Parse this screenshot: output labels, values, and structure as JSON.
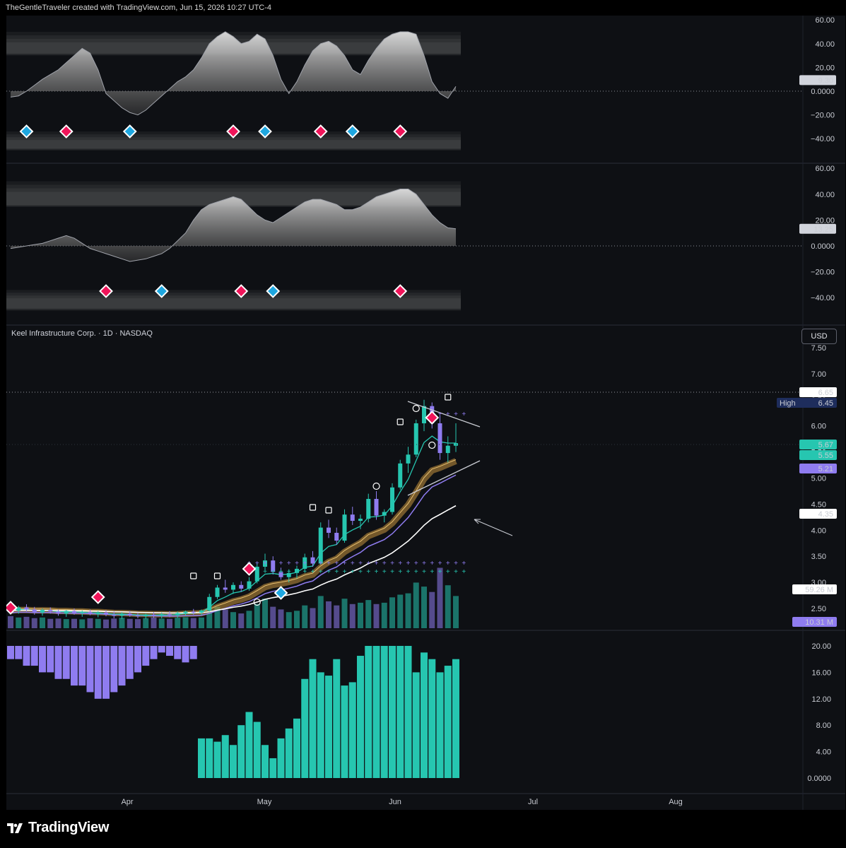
{
  "header": {
    "caption": "TheGentleTraveler created with TradingView.com, Jun 15, 2026 10:27 UTC-4"
  },
  "symbol": {
    "name": "Keel Infrastructure Corp.",
    "interval": "1D",
    "exchange": "NASDAQ",
    "legend": "Keel Infrastructure Corp. · 1D · NASDAQ"
  },
  "currency": "USD",
  "colors": {
    "background": "#0e1014",
    "teal": "#26c6b0",
    "purple": "#8f7cf0",
    "magenta": "#f0155a",
    "cyan": "#1ea7e0",
    "gold": "#b8893a",
    "white": "#ffffff"
  },
  "oscillator1": {
    "axis_ticks": [
      "60.00",
      "40.00",
      "20.00",
      "0.0000",
      "−20.00",
      "−40.00"
    ],
    "tick_values": [
      60,
      40,
      20,
      0,
      -20,
      -40
    ],
    "value_badge": "9.30",
    "value": 9.3,
    "signals": [
      {
        "bar": 2,
        "type": "bullish"
      },
      {
        "bar": 7,
        "type": "bearish"
      },
      {
        "bar": 15,
        "type": "bullish"
      },
      {
        "bar": 28,
        "type": "bearish"
      },
      {
        "bar": 32,
        "type": "bullish"
      },
      {
        "bar": 39,
        "type": "bearish"
      },
      {
        "bar": 43,
        "type": "bullish"
      },
      {
        "bar": 49,
        "type": "bearish"
      }
    ]
  },
  "oscillator2": {
    "axis_ticks": [
      "60.00",
      "40.00",
      "20.00",
      "0.0000",
      "−20.00",
      "−40.00"
    ],
    "tick_values": [
      60,
      40,
      20,
      0,
      -20,
      -40
    ],
    "value_badge": "13.25",
    "value": 13.25,
    "signals": [
      {
        "bar": 12,
        "type": "bearish"
      },
      {
        "bar": 19,
        "type": "bullish"
      },
      {
        "bar": 29,
        "type": "bearish"
      },
      {
        "bar": 33,
        "type": "bullish"
      },
      {
        "bar": 49,
        "type": "bearish"
      }
    ]
  },
  "price_pane": {
    "axis_ticks": [
      "7.50",
      "7.00",
      "6.50",
      "6.00",
      "5.50",
      "5.00",
      "4.50",
      "4.00",
      "3.50",
      "3.00",
      "2.50"
    ],
    "tick_values": [
      7.5,
      7.0,
      6.5,
      6.0,
      5.5,
      5.0,
      4.5,
      4.0,
      3.5,
      3.0,
      2.5
    ],
    "badges": {
      "last_high": "6.65",
      "high_label": "High",
      "high_value": "6.45",
      "close": "5.67",
      "ema_fast": "5.55",
      "ema_slow": "5.21",
      "sma": "4.35",
      "volume_ma": "59.26 M",
      "volume": "10.31 M"
    }
  },
  "histogram_pane": {
    "axis_ticks": [
      "20.00",
      "16.00",
      "12.00",
      "8.00",
      "4.00",
      "0.0000"
    ],
    "tick_values": [
      20,
      16,
      12,
      8,
      4,
      0
    ]
  },
  "time_axis": {
    "labels": [
      "Apr",
      "May",
      "Jun",
      "Jul",
      "Aug"
    ]
  },
  "footer": {
    "brand": "TradingView"
  },
  "chart_data": {
    "type": "candlestick",
    "title": "Keel Infrastructure Corp. · 1D · NASDAQ",
    "ylim": [
      2.5,
      7.5
    ],
    "candles": [
      {
        "o": 2.5,
        "h": 2.56,
        "l": 2.4,
        "c": 2.46
      },
      {
        "o": 2.46,
        "h": 2.55,
        "l": 2.4,
        "c": 2.52
      },
      {
        "o": 2.52,
        "h": 2.58,
        "l": 2.44,
        "c": 2.48
      },
      {
        "o": 2.48,
        "h": 2.53,
        "l": 2.38,
        "c": 2.42
      },
      {
        "o": 2.42,
        "h": 2.5,
        "l": 2.36,
        "c": 2.47
      },
      {
        "o": 2.47,
        "h": 2.52,
        "l": 2.4,
        "c": 2.44
      },
      {
        "o": 2.44,
        "h": 2.48,
        "l": 2.36,
        "c": 2.4
      },
      {
        "o": 2.4,
        "h": 2.47,
        "l": 2.34,
        "c": 2.45
      },
      {
        "o": 2.45,
        "h": 2.5,
        "l": 2.38,
        "c": 2.41
      },
      {
        "o": 2.41,
        "h": 2.46,
        "l": 2.34,
        "c": 2.43
      },
      {
        "o": 2.43,
        "h": 2.48,
        "l": 2.37,
        "c": 2.39
      },
      {
        "o": 2.39,
        "h": 2.45,
        "l": 2.33,
        "c": 2.42
      },
      {
        "o": 2.42,
        "h": 2.47,
        "l": 2.35,
        "c": 2.38
      },
      {
        "o": 2.38,
        "h": 2.44,
        "l": 2.31,
        "c": 2.36
      },
      {
        "o": 2.36,
        "h": 2.43,
        "l": 2.3,
        "c": 2.4
      },
      {
        "o": 2.4,
        "h": 2.45,
        "l": 2.34,
        "c": 2.37
      },
      {
        "o": 2.37,
        "h": 2.42,
        "l": 2.31,
        "c": 2.35
      },
      {
        "o": 2.35,
        "h": 2.4,
        "l": 2.3,
        "c": 2.38
      },
      {
        "o": 2.38,
        "h": 2.43,
        "l": 2.32,
        "c": 2.36
      },
      {
        "o": 2.36,
        "h": 2.42,
        "l": 2.31,
        "c": 2.39
      },
      {
        "o": 2.39,
        "h": 2.45,
        "l": 2.33,
        "c": 2.37
      },
      {
        "o": 2.37,
        "h": 2.44,
        "l": 2.32,
        "c": 2.41
      },
      {
        "o": 2.41,
        "h": 2.46,
        "l": 2.36,
        "c": 2.44
      },
      {
        "o": 2.44,
        "h": 2.49,
        "l": 2.38,
        "c": 2.42
      },
      {
        "o": 2.42,
        "h": 2.48,
        "l": 2.37,
        "c": 2.46
      },
      {
        "o": 2.46,
        "h": 2.78,
        "l": 2.44,
        "c": 2.72
      },
      {
        "o": 2.72,
        "h": 2.95,
        "l": 2.68,
        "c": 2.9
      },
      {
        "o": 2.9,
        "h": 3.05,
        "l": 2.8,
        "c": 2.86
      },
      {
        "o": 2.86,
        "h": 3.0,
        "l": 2.78,
        "c": 2.95
      },
      {
        "o": 2.95,
        "h": 3.02,
        "l": 2.82,
        "c": 2.88
      },
      {
        "o": 2.88,
        "h": 3.1,
        "l": 2.84,
        "c": 3.02
      },
      {
        "o": 3.02,
        "h": 3.38,
        "l": 2.98,
        "c": 3.3
      },
      {
        "o": 3.3,
        "h": 3.55,
        "l": 3.22,
        "c": 3.42
      },
      {
        "o": 3.42,
        "h": 3.5,
        "l": 3.15,
        "c": 3.2
      },
      {
        "o": 3.2,
        "h": 3.28,
        "l": 3.05,
        "c": 3.1
      },
      {
        "o": 3.1,
        "h": 3.25,
        "l": 3.0,
        "c": 3.18
      },
      {
        "o": 3.18,
        "h": 3.32,
        "l": 3.08,
        "c": 3.26
      },
      {
        "o": 3.26,
        "h": 3.55,
        "l": 3.2,
        "c": 3.48
      },
      {
        "o": 3.48,
        "h": 3.6,
        "l": 3.3,
        "c": 3.36
      },
      {
        "o": 3.36,
        "h": 4.15,
        "l": 3.34,
        "c": 4.05
      },
      {
        "o": 4.05,
        "h": 4.2,
        "l": 3.85,
        "c": 3.95
      },
      {
        "o": 3.95,
        "h": 4.05,
        "l": 3.72,
        "c": 3.8
      },
      {
        "o": 3.8,
        "h": 4.4,
        "l": 3.76,
        "c": 4.3
      },
      {
        "o": 4.3,
        "h": 4.45,
        "l": 4.1,
        "c": 4.18
      },
      {
        "o": 4.18,
        "h": 4.3,
        "l": 4.02,
        "c": 4.22
      },
      {
        "o": 4.22,
        "h": 4.7,
        "l": 4.15,
        "c": 4.6
      },
      {
        "o": 4.6,
        "h": 4.75,
        "l": 4.2,
        "c": 4.28
      },
      {
        "o": 4.28,
        "h": 4.4,
        "l": 4.15,
        "c": 4.35
      },
      {
        "o": 4.35,
        "h": 4.9,
        "l": 4.3,
        "c": 4.82
      },
      {
        "o": 4.82,
        "h": 5.35,
        "l": 4.78,
        "c": 5.28
      },
      {
        "o": 5.28,
        "h": 5.6,
        "l": 5.1,
        "c": 5.45
      },
      {
        "o": 5.45,
        "h": 6.12,
        "l": 5.4,
        "c": 6.05
      },
      {
        "o": 6.05,
        "h": 6.5,
        "l": 5.9,
        "c": 6.38
      },
      {
        "o": 6.38,
        "h": 6.45,
        "l": 5.95,
        "c": 6.05
      },
      {
        "o": 6.05,
        "h": 6.2,
        "l": 5.35,
        "c": 5.48
      },
      {
        "o": 5.48,
        "h": 5.8,
        "l": 5.3,
        "c": 5.62
      },
      {
        "o": 5.62,
        "h": 6.05,
        "l": 5.5,
        "c": 5.67
      }
    ],
    "volume": [
      0.9,
      0.8,
      0.85,
      0.75,
      0.8,
      0.7,
      0.72,
      0.68,
      0.7,
      0.66,
      0.74,
      0.7,
      0.65,
      0.72,
      0.78,
      0.7,
      0.68,
      0.75,
      0.8,
      0.72,
      0.7,
      0.78,
      0.82,
      0.76,
      0.8,
      1.3,
      1.6,
      1.4,
      1.2,
      1.1,
      1.3,
      1.8,
      2.2,
      1.6,
      1.4,
      1.2,
      1.3,
      1.7,
      1.5,
      2.4,
      2.0,
      1.7,
      2.2,
      1.8,
      1.9,
      2.1,
      1.8,
      1.9,
      2.3,
      2.5,
      2.6,
      3.4,
      3.1,
      2.7,
      4.5,
      3.2,
      2.4
    ],
    "histogram": [
      {
        "v": 18,
        "c": "purple"
      },
      {
        "v": 18,
        "c": "purple"
      },
      {
        "v": 17,
        "c": "purple"
      },
      {
        "v": 17,
        "c": "purple"
      },
      {
        "v": 16,
        "c": "purple"
      },
      {
        "v": 16,
        "c": "purple"
      },
      {
        "v": 15,
        "c": "purple"
      },
      {
        "v": 15,
        "c": "purple"
      },
      {
        "v": 14,
        "c": "purple"
      },
      {
        "v": 14,
        "c": "purple"
      },
      {
        "v": 13,
        "c": "purple"
      },
      {
        "v": 12,
        "c": "purple"
      },
      {
        "v": 12,
        "c": "purple"
      },
      {
        "v": 13,
        "c": "purple"
      },
      {
        "v": 14,
        "c": "purple"
      },
      {
        "v": 15,
        "c": "purple"
      },
      {
        "v": 16,
        "c": "purple"
      },
      {
        "v": 17,
        "c": "purple"
      },
      {
        "v": 18,
        "c": "purple"
      },
      {
        "v": 19,
        "c": "purple"
      },
      {
        "v": 18.5,
        "c": "purple"
      },
      {
        "v": 18,
        "c": "purple"
      },
      {
        "v": 17.5,
        "c": "purple"
      },
      {
        "v": 18,
        "c": "purple"
      },
      {
        "v": 6,
        "c": "teal"
      },
      {
        "v": 6,
        "c": "teal"
      },
      {
        "v": 5.5,
        "c": "teal"
      },
      {
        "v": 6.5,
        "c": "teal"
      },
      {
        "v": 5,
        "c": "teal"
      },
      {
        "v": 8,
        "c": "teal"
      },
      {
        "v": 10,
        "c": "teal"
      },
      {
        "v": 8.5,
        "c": "teal"
      },
      {
        "v": 5,
        "c": "teal"
      },
      {
        "v": 3,
        "c": "teal"
      },
      {
        "v": 6,
        "c": "teal"
      },
      {
        "v": 7.5,
        "c": "teal"
      },
      {
        "v": 9,
        "c": "teal"
      },
      {
        "v": 15,
        "c": "teal"
      },
      {
        "v": 18,
        "c": "teal"
      },
      {
        "v": 16,
        "c": "teal"
      },
      {
        "v": 15.5,
        "c": "teal"
      },
      {
        "v": 18,
        "c": "teal"
      },
      {
        "v": 14,
        "c": "teal"
      },
      {
        "v": 14.5,
        "c": "teal"
      },
      {
        "v": 18.5,
        "c": "teal"
      },
      {
        "v": 20,
        "c": "teal"
      },
      {
        "v": 20,
        "c": "teal"
      },
      {
        "v": 20,
        "c": "teal"
      },
      {
        "v": 20,
        "c": "teal"
      },
      {
        "v": 20,
        "c": "teal"
      },
      {
        "v": 20,
        "c": "teal"
      },
      {
        "v": 16,
        "c": "teal"
      },
      {
        "v": 19,
        "c": "teal"
      },
      {
        "v": 18,
        "c": "teal"
      },
      {
        "v": 16,
        "c": "teal"
      },
      {
        "v": 17,
        "c": "teal"
      },
      {
        "v": 18,
        "c": "teal"
      }
    ],
    "oscillator1_series": [
      -5,
      -4,
      0,
      5,
      10,
      14,
      18,
      24,
      30,
      36,
      32,
      18,
      -2,
      -8,
      -14,
      -18,
      -20,
      -16,
      -10,
      -4,
      2,
      8,
      12,
      18,
      28,
      40,
      46,
      50,
      46,
      40,
      42,
      48,
      44,
      30,
      10,
      -2,
      8,
      22,
      34,
      40,
      42,
      38,
      30,
      18,
      14,
      26,
      36,
      44,
      48,
      50,
      50,
      48,
      30,
      8,
      -2,
      -6,
      4
    ],
    "oscillator2_series": [
      -2,
      -1,
      0,
      1,
      2,
      4,
      6,
      8,
      6,
      2,
      -2,
      -4,
      -6,
      -8,
      -10,
      -12,
      -11,
      -10,
      -8,
      -6,
      -2,
      4,
      10,
      20,
      28,
      32,
      34,
      36,
      38,
      36,
      30,
      24,
      20,
      18,
      22,
      26,
      30,
      34,
      36,
      36,
      34,
      32,
      28,
      28,
      30,
      34,
      38,
      40,
      42,
      44,
      44,
      40,
      32,
      24,
      18,
      14,
      13.25
    ]
  }
}
